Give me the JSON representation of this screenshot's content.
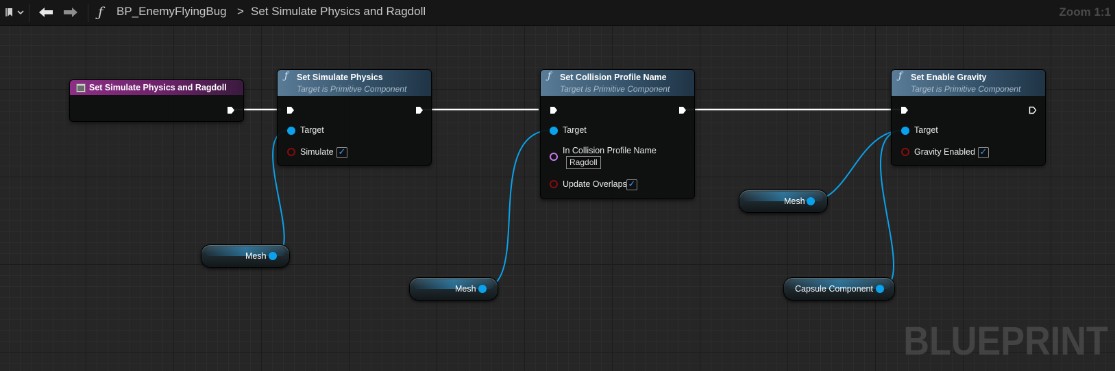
{
  "toolbar": {
    "breadcrumb_blueprint": "BP_EnemyFlyingBug",
    "breadcrumb_separator": ">",
    "breadcrumb_function": "Set Simulate Physics and Ragdoll",
    "zoom": "Zoom 1:1"
  },
  "graph": {
    "event_node": {
      "title": "Set Simulate Physics and Ragdoll"
    },
    "node_simulate": {
      "title": "Set Simulate Physics",
      "subtitle": "Target is Primitive Component",
      "pin_target": "Target",
      "pin_simulate": "Simulate",
      "simulate_checked": true
    },
    "node_collision": {
      "title": "Set Collision Profile Name",
      "subtitle": "Target is Primitive Component",
      "pin_target": "Target",
      "pin_profile": "In Collision Profile Name",
      "profile_value": "Ragdoll",
      "pin_overlaps": "Update Overlaps",
      "overlaps_checked": true
    },
    "node_gravity": {
      "title": "Set Enable Gravity",
      "subtitle": "Target is Primitive Component",
      "pin_target": "Target",
      "pin_gravity": "Gravity Enabled",
      "gravity_checked": true
    },
    "var_mesh_1": {
      "label": "Mesh"
    },
    "var_mesh_2": {
      "label": "Mesh"
    },
    "var_mesh_3": {
      "label": "Mesh"
    },
    "var_capsule": {
      "label": "Capsule Component"
    },
    "checkmark": "✓",
    "watermark": "BLUEPRINT"
  },
  "colors": {
    "exec_wire": "#ffffff",
    "object_pin": "#0aa2ec",
    "bool_pin": "#8a0b0b",
    "name_pin": "#c579ea",
    "function_header": "#36546c",
    "event_header": "#8d2f86"
  }
}
